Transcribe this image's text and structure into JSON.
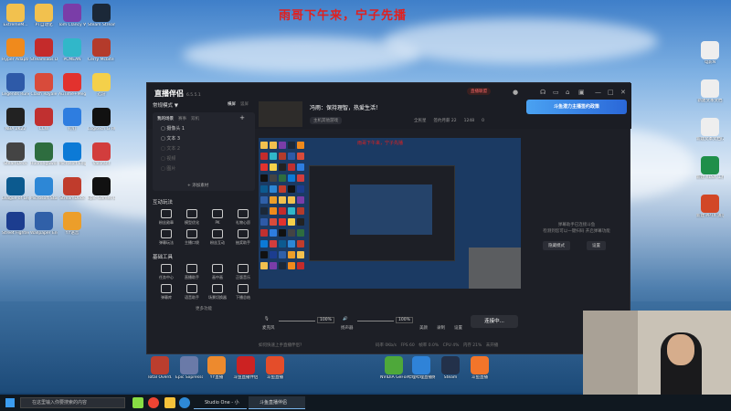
{
  "headline": "雨哥下午来，宁子先播",
  "desktop_icons": [
    {
      "label": "ExtremeM...",
      "color": "#f2c14e"
    },
    {
      "label": "PT自动化",
      "color": "#f2c14e"
    },
    {
      "label": "Tom Clancy WildLands",
      "color": "#7a3da8"
    },
    {
      "label": "Steam Streaming",
      "color": "#1b2838"
    },
    {
      "label": "Hyper Adaptive Play",
      "color": "#f08a1c"
    },
    {
      "label": "Streamlabs Desktop",
      "color": "#c42b2b"
    },
    {
      "label": "PCMEAN",
      "color": "#31b7c9"
    },
    {
      "label": "Cerry Mcbite 3",
      "color": "#b43b2b"
    },
    {
      "label": "Legends Runeterra",
      "color": "#2e5aa8"
    },
    {
      "label": "Clash Royale",
      "color": "#d84b3b"
    },
    {
      "label": "AuTime+Mega",
      "color": "#e2322e"
    },
    {
      "label": "迅游",
      "color": "#f4d04a"
    },
    {
      "label": "NBA 2K22",
      "color": "#222"
    },
    {
      "label": "CCW",
      "color": "#c03030"
    },
    {
      "label": "钉钉",
      "color": "#2e7de0"
    },
    {
      "label": "Logitech G HUB",
      "color": "#111"
    },
    {
      "label": "SteamDeck",
      "color": "#444"
    },
    {
      "label": "HuorongSword",
      "color": "#2e6d3f"
    },
    {
      "label": "Microsoft Edge",
      "color": "#0c7ad6"
    },
    {
      "label": "Valorant",
      "color": "#d23d3d"
    },
    {
      "label": "League of Legends",
      "color": "#0c5a8f"
    },
    {
      "label": "Microsoft Store",
      "color": "#2d87d6"
    },
    {
      "label": "StreamDock",
      "color": "#c03c2c"
    },
    {
      "label": "Epic Games Launcher",
      "color": "#111"
    },
    {
      "label": "Street Fighter V",
      "color": "#1c3d8f"
    },
    {
      "label": "Wallpaper Engine",
      "color": "#3060a8"
    },
    {
      "label": "YY语音",
      "color": "#ec9e2a"
    }
  ],
  "taskbar_icons": [
    {
      "label": "Total Overd.",
      "color": "#bb3e2e"
    },
    {
      "label": "Epic Sxpresso",
      "color": "#6a7aa8"
    },
    {
      "label": "YY直播",
      "color": "#ed8a2e"
    },
    {
      "label": "斗鱼直播伴侣",
      "color": "#c22"
    },
    {
      "label": "斗鱼直播",
      "color": "#e44d2a"
    },
    {
      "label": "NVIDIA GeForce",
      "color": "#4ea83a"
    },
    {
      "label": "哔哩哔哩直播姬",
      "color": "#2f83d8"
    },
    {
      "label": "Steam",
      "color": "#23314a"
    },
    {
      "label": "斗鱼直播",
      "color": "#f2752a"
    }
  ],
  "right_desktop_icons": [
    {
      "label": "电影N",
      "color": "#eee"
    },
    {
      "label": "新建文本文档",
      "color": "#eee"
    },
    {
      "label": "新建文本文档(2)",
      "color": "#eee"
    },
    {
      "label": "新建 XLSX 工作表",
      "color": "#1f8f4a"
    },
    {
      "label": "新建 PPTX 演示文稿",
      "color": "#d24726"
    }
  ],
  "app": {
    "name": "直播伴侣",
    "version": "6.5.5.1",
    "mode": "常规模式 ▼",
    "scenes_label": "我的场景",
    "scene_tabs": [
      "我的场景",
      "赛事",
      "双机"
    ],
    "sources": [
      {
        "name": "摄像头 1",
        "dim": false
      },
      {
        "name": "文本 3",
        "dim": false
      },
      {
        "name": "文本 2",
        "dim": true
      },
      {
        "name": "视频",
        "dim": true
      },
      {
        "name": "图片",
        "dim": true
      }
    ],
    "add_source": "+ 添加素材",
    "landscape": "横屏",
    "portrait": "竖屏",
    "interact_title": "互动玩法",
    "interact_tools": [
      "粉丝勋章",
      "模型优化",
      "PK",
      "礼物心愿",
      "弹幕玩法",
      "主播口袋",
      "粉丝互动",
      "抽奖助手"
    ],
    "basic_title": "基础工具",
    "basic_tools": [
      "任务中心",
      "直播助手",
      "画中画",
      "正版音乐",
      "弹幕库",
      "语音助手",
      "场景切换器",
      "下播总结"
    ],
    "more_tools": "更多功能",
    "stream_title": "冯雨：保持理智，热爱生活！",
    "stream_category": "主机其他游戏",
    "stats": [
      "全民星",
      "签约月薪 22",
      "1248",
      "0"
    ],
    "status_badge": "直播联盟",
    "preview_title": "雨哥下午来，宁子先播",
    "mic_label": "麦克风",
    "mic_pct": "100%",
    "speaker_label": "扬声器",
    "speaker_pct": "100%",
    "tools_bottom": [
      "美颜",
      "录制",
      "设置"
    ],
    "start_btn": "连接中...",
    "status_text": "如何快速上手直播伴侣?",
    "status_stats": "码率 0Kb/s　FPS 60　帧率 0.0%　CPU 4%　内存 21%　未开播",
    "banner": "斗鱼潜力主播签约政策",
    "rp_text1": "弹幕助手已连接斗鱼",
    "rp_text2": "检测到您可以一键扫码 开启弹幕功能",
    "rp_btn1": "隐藏模式",
    "rp_btn2": "设置"
  },
  "taskbar": {
    "search": "在这里输入你要搜索的内容",
    "app1": "Studio One - 小天...",
    "app2": "斗鱼直播伴侣"
  }
}
